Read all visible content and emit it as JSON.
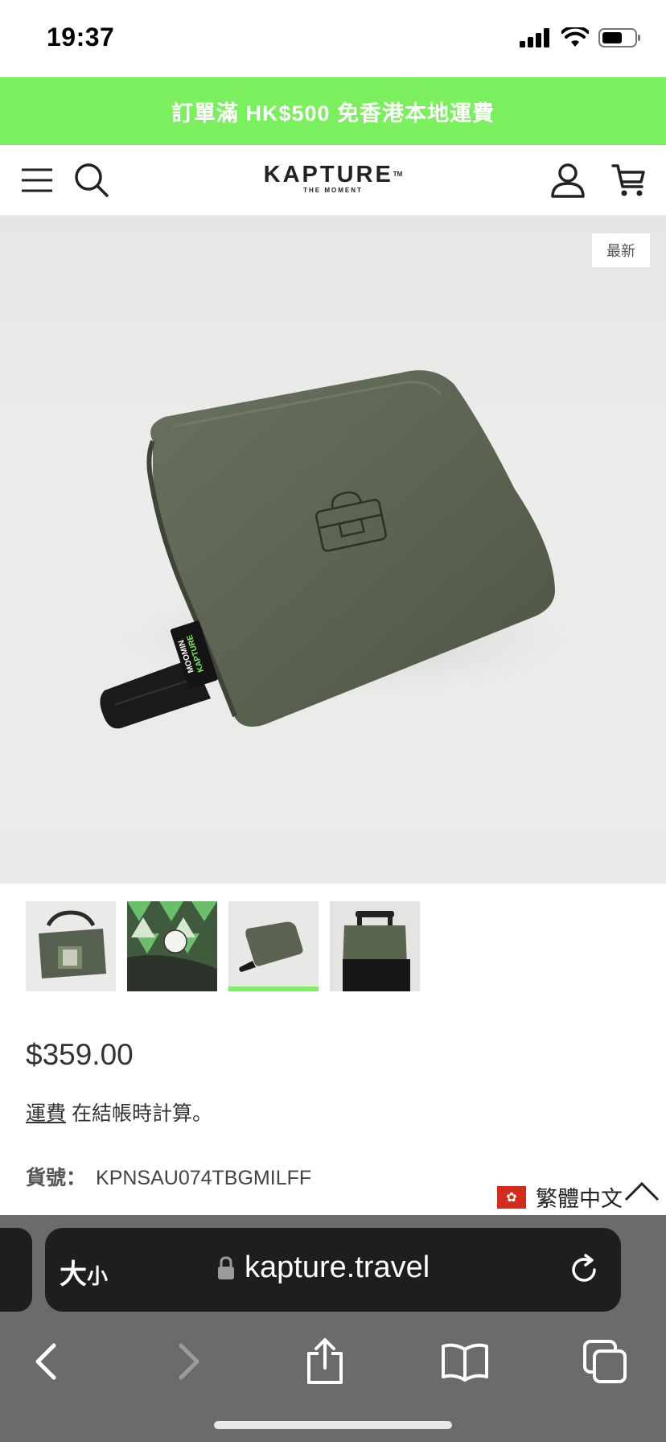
{
  "status_bar": {
    "time": "19:37"
  },
  "promo": {
    "text": "訂單滿 HK$500 免香港本地運費"
  },
  "header": {
    "logo_main": "KAPTURE",
    "logo_tm": "TM",
    "logo_sub": "THE MOMENT"
  },
  "hero": {
    "badge": "最新",
    "tag_text": "KAPTURE / MOOMIN"
  },
  "thumbnails": {
    "count": 4,
    "active_index": 2
  },
  "product": {
    "price": "$359.00",
    "shipping_prefix": "運費",
    "shipping_suffix": " 在結帳時計算。",
    "sku_label": "貨號：",
    "sku_value": "KPNSAU074TBGMILFF"
  },
  "language": {
    "flag": "✿",
    "label": "繁體中文"
  },
  "browser": {
    "aa_big": "大",
    "aa_small": "小",
    "url": "kapture.travel"
  },
  "colors": {
    "accent": "#7bf05f",
    "bag": "#5b6450",
    "safari_bg": "#6b6b6b"
  }
}
